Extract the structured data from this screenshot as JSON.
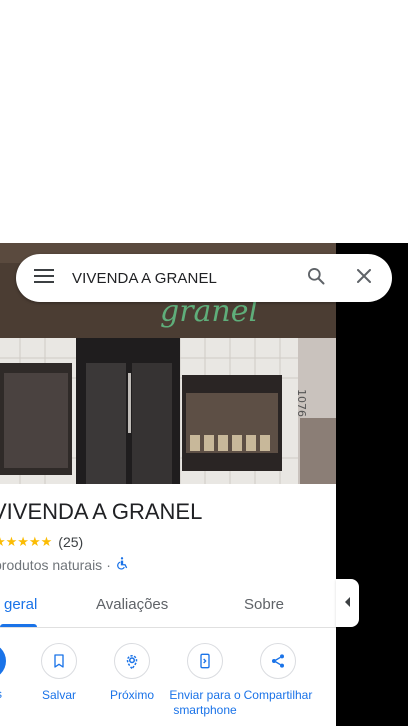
{
  "search": {
    "query": "VIVENDA A GRANEL"
  },
  "place": {
    "name": "VIVENDA A GRANEL",
    "stars_display": "★★★★★",
    "rating_value": 5,
    "review_count": "(25)",
    "category": "produtos naturais",
    "separator": "·",
    "accessibility_icon": "wheelchair-icon"
  },
  "tabs": [
    {
      "label": "geral",
      "active": true
    },
    {
      "label": "Avaliações",
      "active": false
    },
    {
      "label": "Sobre",
      "active": false
    }
  ],
  "actions": {
    "partial_label": "s",
    "save": {
      "label": "Salvar",
      "icon": "bookmark-icon"
    },
    "nearby": {
      "label": "Próximo",
      "icon": "nearby-icon"
    },
    "send": {
      "label": "Enviar para o smartphone",
      "icon": "send-to-phone-icon"
    },
    "share": {
      "label": "Compartilhar",
      "icon": "share-icon"
    }
  },
  "photo": {
    "sign_text": "granel",
    "address_text": "1076"
  },
  "colors": {
    "accent": "#1a73e8",
    "star": "#fbbc04",
    "text": "#202124",
    "secondary": "#70757a"
  }
}
